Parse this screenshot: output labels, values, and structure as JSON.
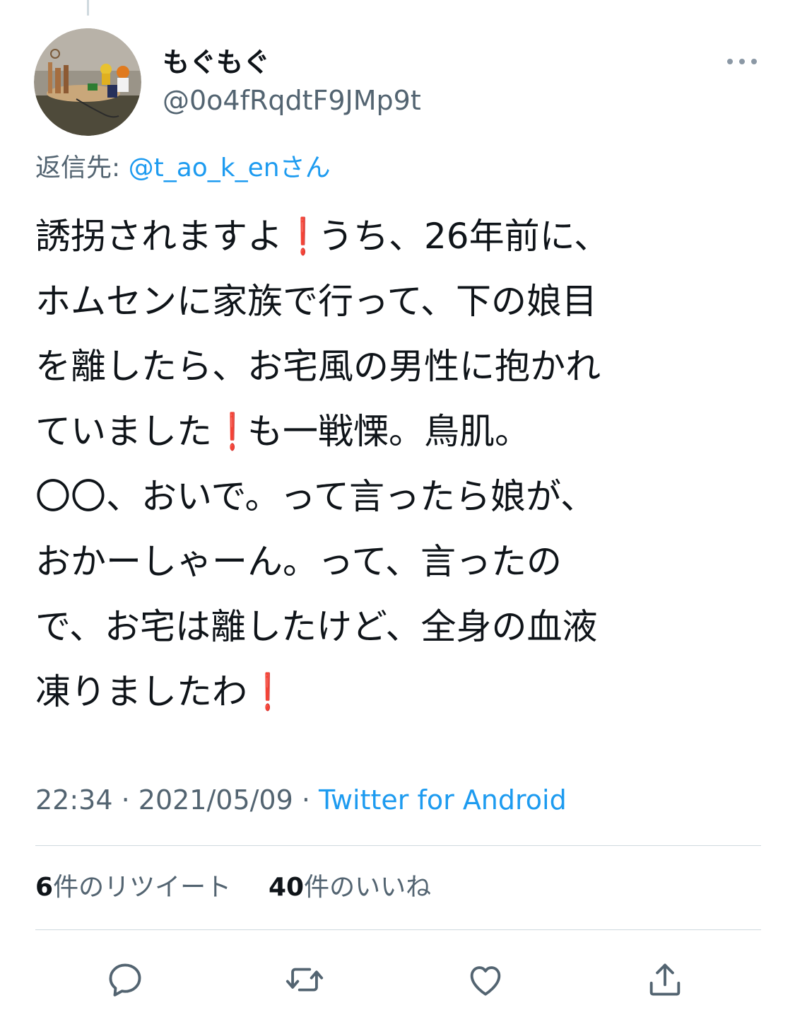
{
  "user": {
    "display_name": "もぐもぐ",
    "handle": "@0o4fRqdtF9JMp9t"
  },
  "reply": {
    "prefix": "返信先: ",
    "mention": "@t_ao_k_en",
    "suffix": "さん"
  },
  "tweet": {
    "lines": [
      [
        "誘拐されますよ",
        "❗",
        "うち、26年前に、"
      ],
      [
        "ホムセンに家族で行って、下の娘目"
      ],
      [
        "を離したら、お宅風の男性に抱かれ"
      ],
      [
        "ていました",
        "❗",
        "も一戦慄。鳥肌。"
      ],
      [
        "〇〇、おいで。って言ったら娘が、"
      ],
      [
        "おかーしゃーん。って、言ったの"
      ],
      [
        "で、お宅は離したけど、全身の血液"
      ],
      [
        "凍りましたわ",
        "❗"
      ]
    ]
  },
  "meta": {
    "time": "22:34",
    "sep1": " · ",
    "date": "2021/05/09",
    "sep2": " · ",
    "source": "Twitter for Android"
  },
  "stats": {
    "retweets_count": "6",
    "retweets_label": "件のリツイート",
    "likes_count": "40",
    "likes_label": "件のいいね"
  },
  "icons": {
    "more": "more-horizontal-icon",
    "reply": "reply-icon",
    "retweet": "retweet-icon",
    "like": "heart-icon",
    "share": "share-icon"
  },
  "colors": {
    "accent": "#1d9bf0",
    "text": "#0f1419",
    "secondary": "#536471",
    "emoji_red": "#e0222b",
    "divider": "#cfd9de"
  }
}
